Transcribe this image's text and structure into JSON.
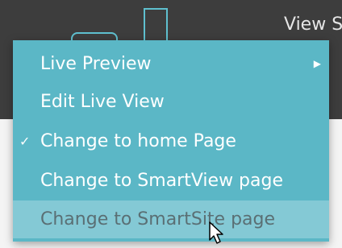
{
  "toolbar": {
    "view_label": "View S"
  },
  "context_menu": {
    "items": [
      {
        "label": "Live Preview",
        "has_submenu": true,
        "checked": false,
        "highlighted": false
      },
      {
        "label": "Edit Live View",
        "has_submenu": false,
        "checked": false,
        "highlighted": false
      },
      {
        "label": "Change to home Page",
        "has_submenu": false,
        "checked": true,
        "highlighted": false
      },
      {
        "label": "Change to SmartView page",
        "has_submenu": false,
        "checked": false,
        "highlighted": false
      },
      {
        "label": "Change to SmartSite page",
        "has_submenu": false,
        "checked": false,
        "highlighted": true
      }
    ]
  },
  "icons": {
    "submenu": "chevron-right-icon",
    "checked": "checkmark-icon",
    "cursor": "mouse-pointer-icon"
  },
  "colors": {
    "menu_bg": "#5bb7c6",
    "menu_highlight": "#84c9d5",
    "toolbar_bg": "#3d3d3d",
    "accent": "#5fc0cf"
  }
}
